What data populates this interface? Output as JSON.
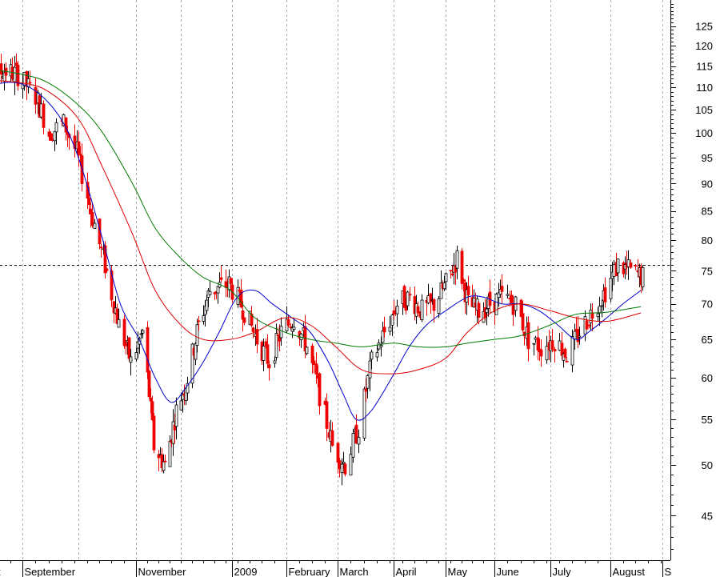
{
  "chart_data": {
    "type": "candlestick",
    "title": "",
    "xlabel": "",
    "ylabel": "",
    "y_scale": "log",
    "ylim": [
      41,
      132
    ],
    "y_ticks": [
      45,
      50,
      55,
      60,
      65,
      70,
      75,
      80,
      85,
      90,
      95,
      100,
      105,
      110,
      115,
      120,
      125
    ],
    "x_tick_labels": [
      {
        "label": "t",
        "date": "2008-08-01"
      },
      {
        "label": "September",
        "date": "2008-09-01"
      },
      {
        "label": "November",
        "date": "2008-11-03"
      },
      {
        "label": "2009",
        "date": "2009-01-02"
      },
      {
        "label": "February",
        "date": "2009-02-02"
      },
      {
        "label": "March",
        "date": "2009-03-02"
      },
      {
        "label": "April",
        "date": "2009-04-01"
      },
      {
        "label": "May",
        "date": "2009-05-01"
      },
      {
        "label": "June",
        "date": "2009-06-01"
      },
      {
        "label": "July",
        "date": "2009-07-01"
      },
      {
        "label": "August",
        "date": "2009-08-03"
      },
      {
        "label": "S",
        "date": "2009-09-01"
      }
    ],
    "x_range": [
      "2008-08-01",
      "2009-09-08"
    ],
    "grid": "vertical dashed at month starts",
    "reference_line": {
      "value": 76,
      "style": "dashed"
    },
    "colors": {
      "up": "#000000",
      "down": "#ee0000",
      "ma_short": "#0000cc",
      "ma_mid": "#dd0000",
      "ma_long": "#007a00"
    },
    "moving_averages": [
      {
        "color": "#0000cc",
        "points": [
          [
            "2008-08-01",
            108
          ],
          [
            "2008-08-20",
            111
          ],
          [
            "2008-09-05",
            110
          ],
          [
            "2008-09-20",
            104
          ],
          [
            "2008-10-01",
            95
          ],
          [
            "2008-10-15",
            80
          ],
          [
            "2008-10-25",
            70
          ],
          [
            "2008-11-05",
            65
          ],
          [
            "2008-11-15",
            60
          ],
          [
            "2008-11-25",
            57
          ],
          [
            "2008-12-05",
            59
          ],
          [
            "2008-12-15",
            62
          ],
          [
            "2008-12-25",
            66
          ],
          [
            "2009-01-05",
            71
          ],
          [
            "2009-01-15",
            72
          ],
          [
            "2009-01-25",
            70
          ],
          [
            "2009-02-05",
            68
          ],
          [
            "2009-02-15",
            66
          ],
          [
            "2009-02-25",
            62
          ],
          [
            "2009-03-05",
            58
          ],
          [
            "2009-03-12",
            55
          ],
          [
            "2009-03-20",
            56
          ],
          [
            "2009-03-31",
            60
          ],
          [
            "2009-04-10",
            64
          ],
          [
            "2009-04-20",
            67
          ],
          [
            "2009-05-01",
            69
          ],
          [
            "2009-05-15",
            71
          ],
          [
            "2009-05-25",
            71
          ],
          [
            "2009-06-05",
            70
          ],
          [
            "2009-06-15",
            70
          ],
          [
            "2009-06-25",
            69
          ],
          [
            "2009-07-05",
            67
          ],
          [
            "2009-07-15",
            65
          ],
          [
            "2009-07-22",
            66
          ],
          [
            "2009-08-01",
            68
          ],
          [
            "2009-08-10",
            70
          ],
          [
            "2009-08-20",
            72
          ]
        ]
      },
      {
        "color": "#dd0000",
        "points": [
          [
            "2008-08-01",
            112
          ],
          [
            "2008-09-01",
            111
          ],
          [
            "2008-09-15",
            109
          ],
          [
            "2008-10-01",
            103
          ],
          [
            "2008-10-15",
            93
          ],
          [
            "2008-11-01",
            81
          ],
          [
            "2008-11-15",
            72
          ],
          [
            "2008-12-01",
            67
          ],
          [
            "2008-12-15",
            65
          ],
          [
            "2009-01-01",
            65
          ],
          [
            "2009-01-15",
            66
          ],
          [
            "2009-02-01",
            68
          ],
          [
            "2009-02-15",
            67
          ],
          [
            "2009-03-01",
            64
          ],
          [
            "2009-03-15",
            61
          ],
          [
            "2009-03-31",
            60.5
          ],
          [
            "2009-04-15",
            61
          ],
          [
            "2009-05-01",
            62.5
          ],
          [
            "2009-05-15",
            66
          ],
          [
            "2009-06-01",
            69
          ],
          [
            "2009-06-15",
            70
          ],
          [
            "2009-07-01",
            69
          ],
          [
            "2009-07-15",
            68
          ],
          [
            "2009-08-01",
            67.5
          ],
          [
            "2009-08-20",
            68.7
          ]
        ]
      },
      {
        "color": "#007a00",
        "points": [
          [
            "2008-08-01",
            115
          ],
          [
            "2008-09-01",
            113
          ],
          [
            "2008-09-15",
            111
          ],
          [
            "2008-10-01",
            106
          ],
          [
            "2008-10-15",
            100
          ],
          [
            "2008-11-01",
            90
          ],
          [
            "2008-11-15",
            82
          ],
          [
            "2008-12-01",
            77
          ],
          [
            "2008-12-15",
            74
          ],
          [
            "2009-01-01",
            72
          ],
          [
            "2009-01-15",
            68
          ],
          [
            "2009-02-01",
            66
          ],
          [
            "2009-02-15",
            65
          ],
          [
            "2009-03-01",
            64.5
          ],
          [
            "2009-03-15",
            64
          ],
          [
            "2009-04-01",
            64.5
          ],
          [
            "2009-04-15",
            64
          ],
          [
            "2009-05-01",
            64
          ],
          [
            "2009-05-15",
            64.5
          ],
          [
            "2009-06-01",
            65
          ],
          [
            "2009-06-15",
            65.5
          ],
          [
            "2009-07-01",
            67
          ],
          [
            "2009-07-15",
            68.5
          ],
          [
            "2009-08-01",
            68.8
          ],
          [
            "2009-08-20",
            69.6
          ]
        ]
      }
    ],
    "price_path": [
      [
        "2008-08-01",
        105
      ],
      [
        "2008-08-10",
        110
      ],
      [
        "2008-08-20",
        114
      ],
      [
        "2008-08-29",
        113
      ],
      [
        "2008-09-08",
        108
      ],
      [
        "2008-09-15",
        100
      ],
      [
        "2008-09-23",
        102
      ],
      [
        "2008-09-30",
        96
      ],
      [
        "2008-10-08",
        85
      ],
      [
        "2008-10-15",
        77
      ],
      [
        "2008-10-24",
        67
      ],
      [
        "2008-10-31",
        62
      ],
      [
        "2008-11-07",
        66
      ],
      [
        "2008-11-14",
        52
      ],
      [
        "2008-11-21",
        50
      ],
      [
        "2008-11-28",
        56
      ],
      [
        "2008-12-05",
        60
      ],
      [
        "2008-12-12",
        67
      ],
      [
        "2008-12-19",
        72
      ],
      [
        "2008-12-31",
        73
      ],
      [
        "2009-01-09",
        69
      ],
      [
        "2009-01-16",
        65
      ],
      [
        "2009-01-23",
        62
      ],
      [
        "2009-01-30",
        66
      ],
      [
        "2009-02-06",
        68
      ],
      [
        "2009-02-13",
        64
      ],
      [
        "2009-02-20",
        58
      ],
      [
        "2009-02-27",
        52
      ],
      [
        "2009-03-06",
        50
      ],
      [
        "2009-03-13",
        54
      ],
      [
        "2009-03-20",
        62
      ],
      [
        "2009-03-27",
        66
      ],
      [
        "2009-04-03",
        70
      ],
      [
        "2009-04-10",
        71
      ],
      [
        "2009-04-17",
        69
      ],
      [
        "2009-04-24",
        70
      ],
      [
        "2009-05-01",
        73
      ],
      [
        "2009-05-08",
        77
      ],
      [
        "2009-05-15",
        70
      ],
      [
        "2009-05-22",
        69
      ],
      [
        "2009-05-29",
        70
      ],
      [
        "2009-06-05",
        71
      ],
      [
        "2009-06-12",
        70
      ],
      [
        "2009-06-19",
        65
      ],
      [
        "2009-06-26",
        64
      ],
      [
        "2009-07-03",
        65
      ],
      [
        "2009-07-10",
        63
      ],
      [
        "2009-07-17",
        66
      ],
      [
        "2009-07-24",
        69
      ],
      [
        "2009-07-31",
        72
      ],
      [
        "2009-08-07",
        76
      ],
      [
        "2009-08-14",
        75
      ],
      [
        "2009-08-21",
        74
      ]
    ]
  }
}
